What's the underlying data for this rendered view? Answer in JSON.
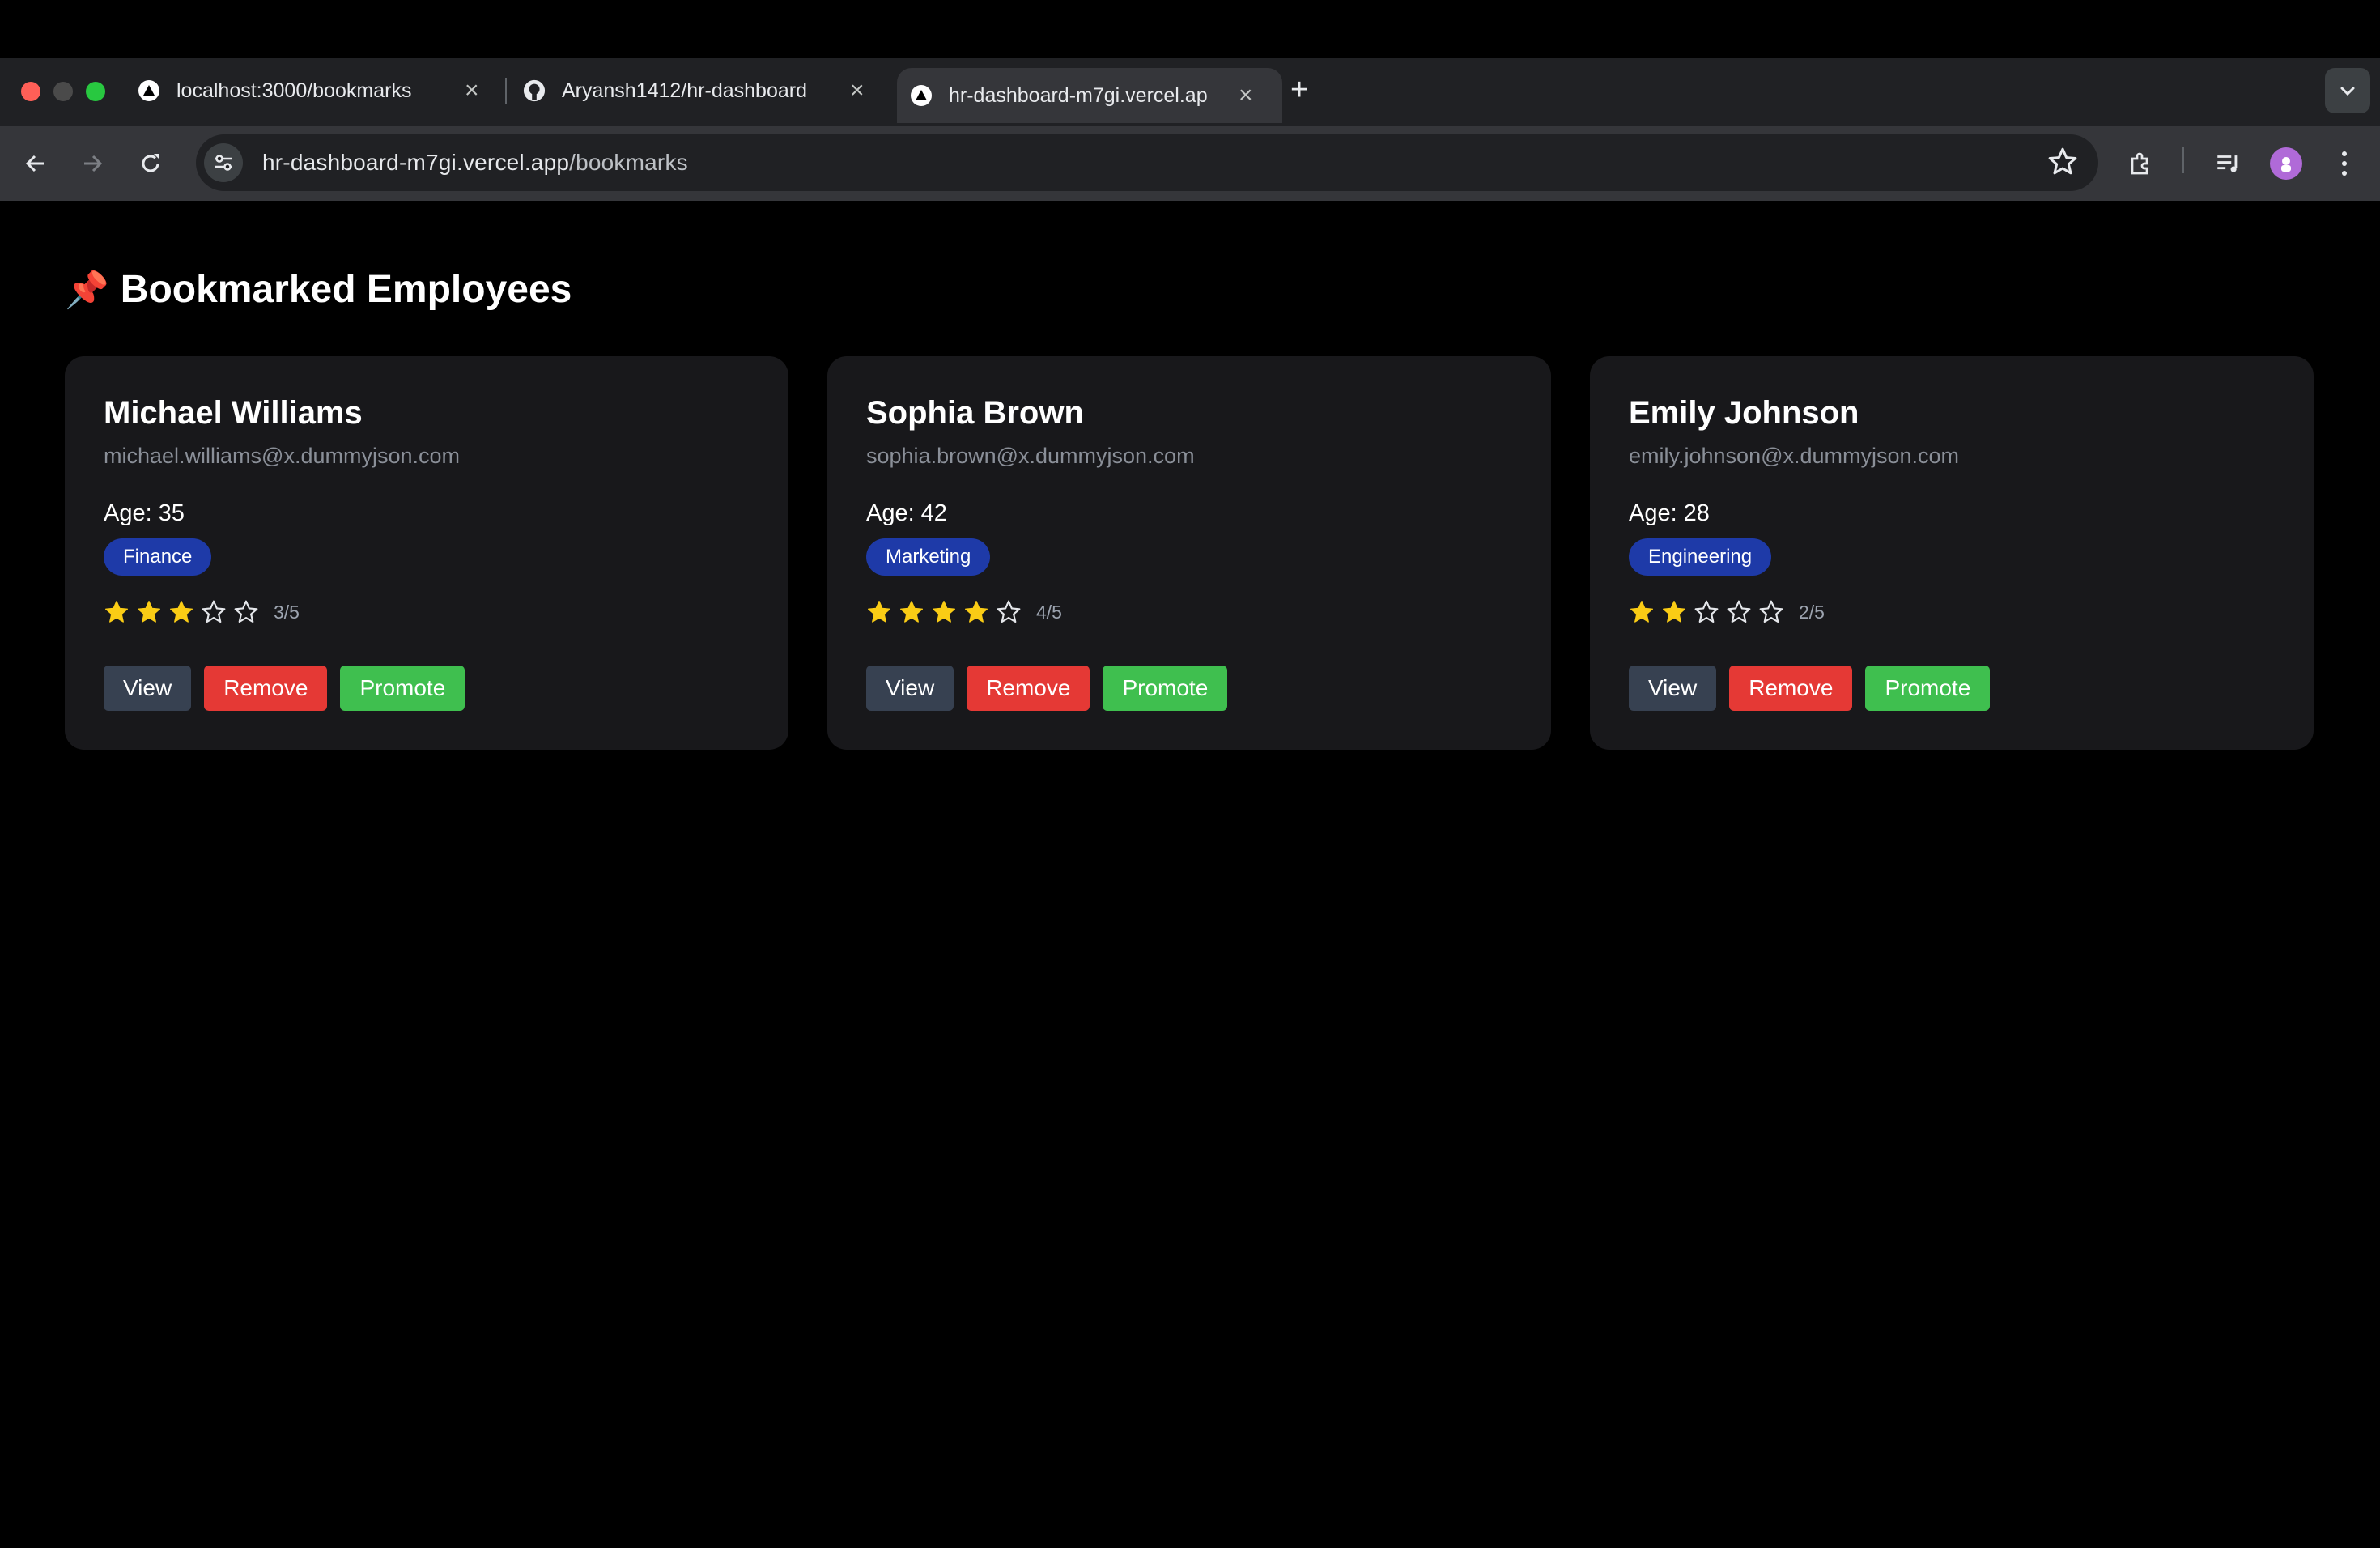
{
  "browser": {
    "tabs": [
      {
        "title": "localhost:3000/bookmarks",
        "icon": "vercel-triangle-icon",
        "active": false
      },
      {
        "title": "Aryansh1412/hr-dashboard",
        "icon": "github-icon",
        "active": false
      },
      {
        "title": "hr-dashboard-m7gi.vercel.ap",
        "icon": "vercel-triangle-icon",
        "active": true
      }
    ],
    "tab_close_glyph": "×",
    "new_tab_glyph": "+",
    "url_host": "hr-dashboard-m7gi.vercel.app",
    "url_path": "/bookmarks"
  },
  "page": {
    "heading_icon": "📌",
    "heading": "Bookmarked Employees"
  },
  "employees": [
    {
      "name": "Michael Williams",
      "email": "michael.williams@x.dummyjson.com",
      "age_label": "Age:",
      "age": "35",
      "department": "Finance",
      "rating": 3,
      "rating_text": "3/5"
    },
    {
      "name": "Sophia Brown",
      "email": "sophia.brown@x.dummyjson.com",
      "age_label": "Age:",
      "age": "42",
      "department": "Marketing",
      "rating": 4,
      "rating_text": "4/5"
    },
    {
      "name": "Emily Johnson",
      "email": "emily.johnson@x.dummyjson.com",
      "age_label": "Age:",
      "age": "28",
      "department": "Engineering",
      "rating": 2,
      "rating_text": "2/5"
    }
  ],
  "buttons": {
    "view": "View",
    "remove": "Remove",
    "promote": "Promote"
  },
  "colors": {
    "page_bg": "#000000",
    "card_bg": "#18181b",
    "star_filled": "#facc15",
    "badge_bg": "#1e3aa8",
    "view_bg": "#374151",
    "remove_bg": "#e53935",
    "promote_bg": "#3fbf4f"
  }
}
